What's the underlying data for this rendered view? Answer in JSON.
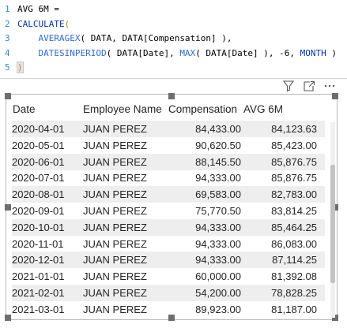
{
  "editor": {
    "lines": [
      {
        "num": "1",
        "parts": [
          {
            "t": "AVG 6M =",
            "c": ""
          }
        ]
      },
      {
        "num": "2",
        "parts": [
          {
            "t": "CALCULATE",
            "c": "kw"
          },
          {
            "t": "(",
            "c": "br"
          }
        ]
      },
      {
        "num": "3",
        "parts": [
          {
            "t": "    ",
            "c": ""
          },
          {
            "t": "AVERAGEX",
            "c": "fn"
          },
          {
            "t": "( DATA, DATA[Compensation] ),",
            "c": ""
          }
        ]
      },
      {
        "num": "4",
        "parts": [
          {
            "t": "    ",
            "c": ""
          },
          {
            "t": "DATESINPERIOD",
            "c": "fn"
          },
          {
            "t": "( DATA[Date], ",
            "c": ""
          },
          {
            "t": "MAX",
            "c": "fn"
          },
          {
            "t": "( DATA[Date] ), -6, ",
            "c": ""
          },
          {
            "t": "MONTH",
            "c": "kw"
          },
          {
            "t": " )",
            "c": ""
          }
        ]
      },
      {
        "num": "5",
        "parts": [
          {
            "t": ")",
            "c": "br paren-hl"
          }
        ]
      }
    ]
  },
  "visual_header": {
    "icons": [
      "filter-icon",
      "focus-mode-icon",
      "more-options-icon"
    ]
  },
  "table": {
    "columns": [
      "Date",
      "Employee Name",
      "Compensation",
      "AVG 6M"
    ],
    "rows": [
      [
        "2020-04-01",
        "JUAN PEREZ",
        "84,433.00",
        "84,123.63"
      ],
      [
        "2020-05-01",
        "JUAN PEREZ",
        "90,620.50",
        "85,423.00"
      ],
      [
        "2020-06-01",
        "JUAN PEREZ",
        "88,145.50",
        "85,876.75"
      ],
      [
        "2020-07-01",
        "JUAN PEREZ",
        "94,333.00",
        "85,876.75"
      ],
      [
        "2020-08-01",
        "JUAN PEREZ",
        "69,583.00",
        "82,783.00"
      ],
      [
        "2020-09-01",
        "JUAN PEREZ",
        "75,770.50",
        "83,814.25"
      ],
      [
        "2020-10-01",
        "JUAN PEREZ",
        "94,333.00",
        "85,464.25"
      ],
      [
        "2020-11-01",
        "JUAN PEREZ",
        "94,333.00",
        "86,083.00"
      ],
      [
        "2020-12-01",
        "JUAN PEREZ",
        "94,333.00",
        "87,114.25"
      ],
      [
        "2021-01-01",
        "JUAN PEREZ",
        "60,000.00",
        "81,392.08"
      ],
      [
        "2021-02-01",
        "JUAN PEREZ",
        "54,200.00",
        "78,828.25"
      ],
      [
        "2021-03-01",
        "JUAN PEREZ",
        "89,923.00",
        "81,187.00"
      ]
    ],
    "scroll_position_fraction": 0.55
  }
}
